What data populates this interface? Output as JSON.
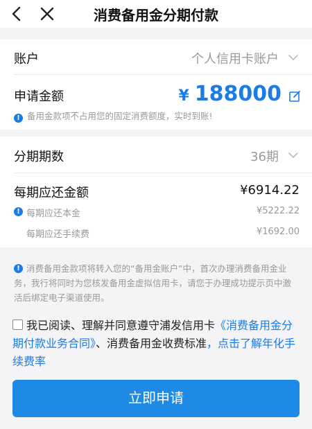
{
  "nav": {
    "title": "消费备用金分期付款"
  },
  "account": {
    "label": "账户",
    "value": "个人信用卡账户"
  },
  "amount": {
    "label": "申请金额",
    "currency": "¥",
    "value": "188000",
    "note": "备用金款项不占用您的固定消费额度，实时到账!"
  },
  "installments": {
    "label": "分期期数",
    "value": "36期"
  },
  "repayment": {
    "label": "每期应还金额",
    "value": "¥6914.22",
    "principal_label": "每期应还本金",
    "principal_value": "¥5222.22",
    "fee_label": "每期应还手续费",
    "fee_value": "¥1692.00"
  },
  "notice": "消费备用金款项将转入您的“备用金账户”中，首次办理消费备用金业务，我行将同时为您核发备用金虚拟信用卡，请您于办理成功提示页中激活后绑定电子渠道使用。",
  "agreement": {
    "prefix": "我已阅读、理解并同意遵守浦发信用卡",
    "contract_link": "《消费备用金分期付款业务合同》",
    "middle": "、消费备用金收费标准",
    "comma": "，",
    "rate_link": "点击了解年化手续费率"
  },
  "apply_button": "立即申请",
  "colors": {
    "accent": "#1a7ce6",
    "button": "#1e8ae6",
    "muted": "#999999"
  }
}
